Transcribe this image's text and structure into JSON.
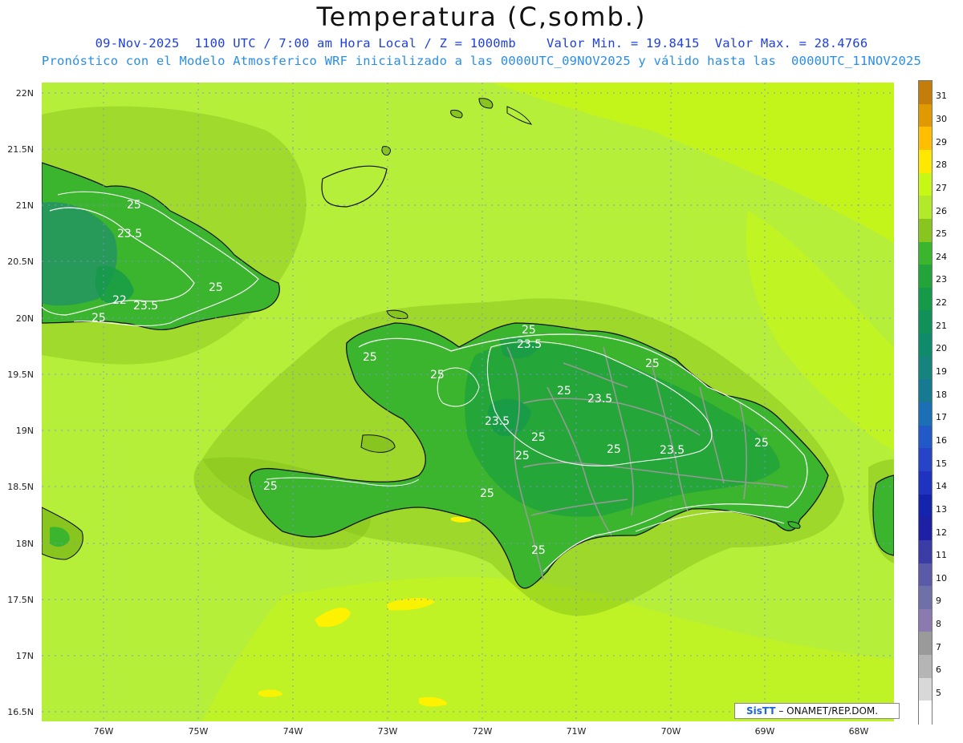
{
  "header": {
    "title": "Temperatura (C,somb.)",
    "line1": "09-Nov-2025  1100 UTC / 7:00 am Hora Local / Z = 1000mb    Valor Min. = 19.8415  Valor Max. = 28.4766",
    "line2": "Pronóstico con el Modelo Atmosferico WRF inicializado a las 0000UTC_09NOV2025 y válido hasta las  0000UTC_11NOV2025"
  },
  "axes": {
    "lat_labels": [
      "22N",
      "21.5N",
      "21N",
      "20.5N",
      "20N",
      "19.5N",
      "19N",
      "18.5N",
      "18N",
      "17.5N",
      "17N",
      "16.5N"
    ],
    "lon_labels": [
      "76W",
      "75W",
      "74W",
      "73W",
      "72W",
      "71W",
      "70W",
      "69W",
      "68W"
    ]
  },
  "colorbar": {
    "levels": [
      "31",
      "30",
      "29",
      "28",
      "27",
      "26",
      "25",
      "24",
      "23",
      "22",
      "21",
      "20",
      "19",
      "18",
      "17",
      "16",
      "15",
      "14",
      "13",
      "12",
      "11",
      "10",
      "9",
      "8",
      "7",
      "6",
      "5"
    ],
    "colors": [
      "#c47d08",
      "#e09a00",
      "#ffbe00",
      "#ffe800",
      "#c7f714",
      "#b2ea2a",
      "#88c51e",
      "#3cb52e",
      "#22a43a",
      "#159a4a",
      "#12905a",
      "#0f8a6a",
      "#15837e",
      "#167a92",
      "#1d6fb5",
      "#2259c9",
      "#2744c8",
      "#1f33c0",
      "#1424ac",
      "#1f1fa6",
      "#3c3ca6",
      "#5a5aa8",
      "#7070a8",
      "#8a7ab0",
      "#9a9a9a",
      "#b5b5b5",
      "#d8d8d8",
      "#ffffff"
    ]
  },
  "contour_labels": [
    {
      "id": "cuba-25-a",
      "text": "25"
    },
    {
      "id": "cuba-235-a",
      "text": "23.5"
    },
    {
      "id": "cuba-25-b",
      "text": "25"
    },
    {
      "id": "cuba-22",
      "text": "22"
    },
    {
      "id": "cuba-235-b",
      "text": "23.5"
    },
    {
      "id": "cuba-25-c",
      "text": "25"
    },
    {
      "id": "nw-25",
      "text": "25"
    },
    {
      "id": "n-25-a",
      "text": "25"
    },
    {
      "id": "n-235",
      "text": "23.5"
    },
    {
      "id": "n-25-b",
      "text": "25"
    },
    {
      "id": "c-25-a",
      "text": "25"
    },
    {
      "id": "c-235-a",
      "text": "23.5"
    },
    {
      "id": "e-25-a",
      "text": "25"
    },
    {
      "id": "c-235-b",
      "text": "23.5"
    },
    {
      "id": "c-25-b",
      "text": "25"
    },
    {
      "id": "c-25-c",
      "text": "25"
    },
    {
      "id": "c-25-d",
      "text": "25"
    },
    {
      "id": "e-235",
      "text": "23.5"
    },
    {
      "id": "e-25-b",
      "text": "25"
    },
    {
      "id": "sw-25-a",
      "text": "25"
    },
    {
      "id": "sw-25-b",
      "text": "25"
    },
    {
      "id": "s-25",
      "text": "25"
    }
  ],
  "credit": {
    "brand": "SisTT",
    "text": " – ONAMET/REP.DOM."
  },
  "map_colors": {
    "sea_warm": "#b6ef3a",
    "sea_warmer": "#c8f614",
    "warm_patch": "#fff200",
    "land_mid": "#88c51e",
    "land_cool": "#3cb52e",
    "land_cooler": "#22a43a",
    "coast": "#111111",
    "borders": "#9a9a9a",
    "contour": "#ffffff",
    "grid": "#8a8ae0"
  }
}
